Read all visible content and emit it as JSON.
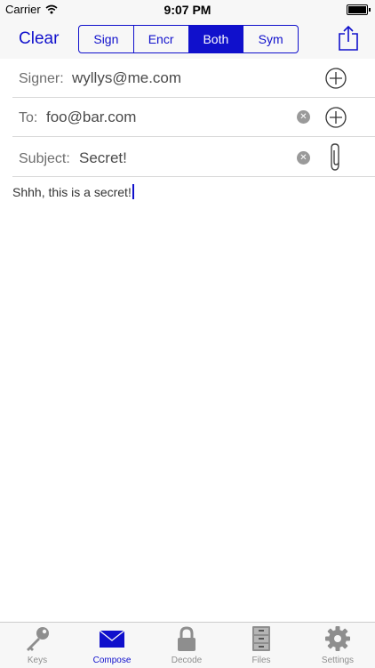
{
  "status_bar": {
    "carrier": "Carrier",
    "time": "9:07 PM"
  },
  "nav": {
    "clear_label": "Clear",
    "segments": [
      "Sign",
      "Encr",
      "Both",
      "Sym"
    ],
    "selected_segment": "Both",
    "share_icon": "share-icon"
  },
  "form": {
    "signer_label": "Signer:",
    "signer_value": "wyllys@me.com",
    "to_label": "To:",
    "to_value": "foo@bar.com",
    "subject_label": "Subject:",
    "subject_value": "Secret!"
  },
  "message_body": "Shhh, this is a secret!",
  "tabs": [
    {
      "label": "Keys",
      "icon": "key-icon"
    },
    {
      "label": "Compose",
      "icon": "envelope-icon",
      "active": true
    },
    {
      "label": "Decode",
      "icon": "lock-icon"
    },
    {
      "label": "Files",
      "icon": "file-cabinet-icon"
    },
    {
      "label": "Settings",
      "icon": "gear-icon"
    }
  ],
  "colors": {
    "accent": "#1010cc",
    "inactive_tab": "#8e8e8e",
    "bar_bg": "#f7f7f7"
  }
}
